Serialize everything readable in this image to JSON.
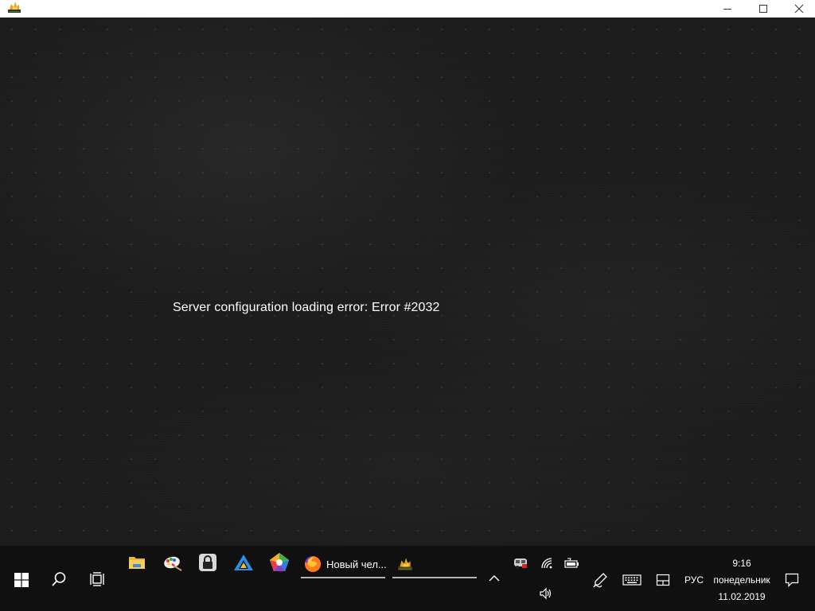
{
  "window": {
    "app_icon": "game-flame-icon",
    "controls": [
      "minimize-icon",
      "maximize-icon",
      "close-icon"
    ]
  },
  "canvas": {
    "error_message": "Server configuration loading error: Error #2032"
  },
  "taskbar": {
    "start_icon": "windows-start-icon",
    "search_icon": "search-icon",
    "taskview_icon": "task-view-icon",
    "pinned": [
      {
        "icon": "file-explorer-icon"
      },
      {
        "icon": "paint-icon"
      },
      {
        "icon": "lock-app-icon"
      },
      {
        "icon": "triangle-app-icon"
      },
      {
        "icon": "pentagon-app-icon"
      }
    ],
    "running": [
      {
        "icon": "firefox-icon",
        "label": "Новый чел..."
      },
      {
        "icon": "game-flame-icon",
        "label": ""
      }
    ],
    "tray": {
      "overflow_icon": "chevron-up-icon",
      "icons": [
        "bus-app-icon",
        "wifi-icon",
        "battery-icon",
        "volume-icon"
      ],
      "pen_icon": "pen-workspace-icon",
      "keyboard_icon": "touch-keyboard-icon",
      "tablet_icon": "tablet-mode-icon",
      "language": "РУС",
      "time": "9:16",
      "day": "понедельник",
      "date": "11.02.2019",
      "notifications_icon": "action-center-icon"
    }
  }
}
